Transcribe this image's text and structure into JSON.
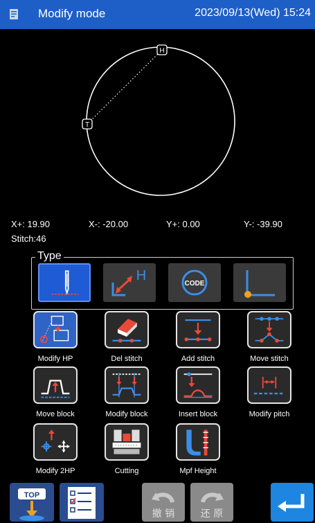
{
  "header": {
    "title": "Modify mode",
    "datetime": "2023/09/13(Wed) 15:24"
  },
  "plot": {
    "hp_marker": "H",
    "tp_marker": "T"
  },
  "coords": {
    "x_plus": "X+: 19.90",
    "x_minus": "X-: -20.00",
    "y_plus": "Y+: 0.00",
    "y_minus": "Y-: -39.90",
    "stitch": "Stitch:46"
  },
  "type_group": {
    "legend": "Type",
    "tiles": [
      {
        "icon": "needle-icon",
        "selected": true
      },
      {
        "icon": "hp-origin-icon",
        "hp_letter": "H",
        "selected": false
      },
      {
        "icon": "code-icon",
        "code_text": "CODE",
        "selected": false
      },
      {
        "icon": "axis-corner-icon",
        "selected": false
      }
    ]
  },
  "functions": [
    {
      "label": "Modify HP",
      "icon": "modify-hp-icon",
      "selected": true
    },
    {
      "label": "Del stitch",
      "icon": "eraser-icon",
      "selected": false
    },
    {
      "label": "Add stitch",
      "icon": "add-stitch-icon",
      "selected": false
    },
    {
      "label": "Move stitch",
      "icon": "move-stitch-icon",
      "selected": false
    },
    {
      "label": "Move block",
      "icon": "move-block-icon",
      "selected": false
    },
    {
      "label": "Modify block",
      "icon": "modify-block-icon",
      "selected": false
    },
    {
      "label": "Insert block",
      "icon": "insert-block-icon",
      "selected": false
    },
    {
      "label": "Modify pitch",
      "icon": "modify-pitch-icon",
      "selected": false
    },
    {
      "label": "Modify 2HP",
      "icon": "modify-2hp-icon",
      "selected": false
    },
    {
      "label": "Cutting",
      "icon": "cutting-icon",
      "selected": false
    },
    {
      "label": "Mpf Height",
      "icon": "mpf-height-icon",
      "selected": false
    }
  ],
  "bottom": {
    "top_label": "TOP",
    "undo_label": "撤 销",
    "redo_label": "还 原"
  },
  "colors": {
    "header_bg": "#1d5fc7",
    "accent_blue": "#3a8ee8",
    "accent_red": "#e84a3a",
    "selected_bg": "#2f63c4"
  }
}
